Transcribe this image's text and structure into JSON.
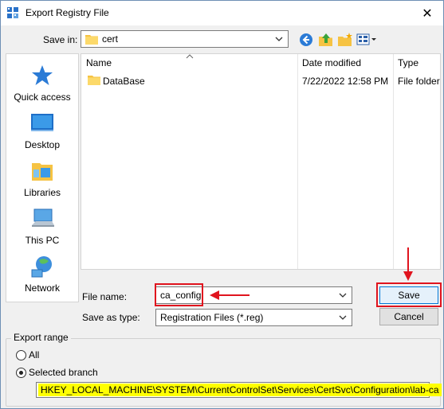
{
  "window": {
    "title": "Export Registry File",
    "close_glyph": "✕"
  },
  "toolbar": {
    "save_in_label": "Save in:",
    "save_in_value": "cert",
    "icons": [
      "back-icon",
      "up-folder-icon",
      "new-folder-icon",
      "view-menu-icon"
    ]
  },
  "sidebar": {
    "items": [
      {
        "label": "Quick access",
        "icon": "star-icon"
      },
      {
        "label": "Desktop",
        "icon": "desktop-icon"
      },
      {
        "label": "Libraries",
        "icon": "libraries-icon"
      },
      {
        "label": "This PC",
        "icon": "computer-icon"
      },
      {
        "label": "Network",
        "icon": "network-icon"
      }
    ]
  },
  "filelist": {
    "columns": [
      "Name",
      "Date modified",
      "Type"
    ],
    "rows": [
      {
        "name": "DataBase",
        "date": "7/22/2022 12:58 PM",
        "type": "File folder"
      }
    ]
  },
  "form": {
    "file_name_label": "File name:",
    "file_name_value": "ca_config",
    "save_as_type_label": "Save as type:",
    "save_as_type_value": "Registration Files (*.reg)",
    "save_label": "Save",
    "cancel_label": "Cancel"
  },
  "export_range": {
    "title": "Export range",
    "all_label": "All",
    "selected_label": "Selected branch",
    "selected": "Selected branch",
    "path": "HKEY_LOCAL_MACHINE\\SYSTEM\\CurrentControlSet\\Services\\CertSvc\\Configuration\\lab-ca"
  },
  "colors": {
    "annotation_red": "#e0141e",
    "highlight_yellow": "#ffff00",
    "accent_blue": "#0078d7"
  }
}
